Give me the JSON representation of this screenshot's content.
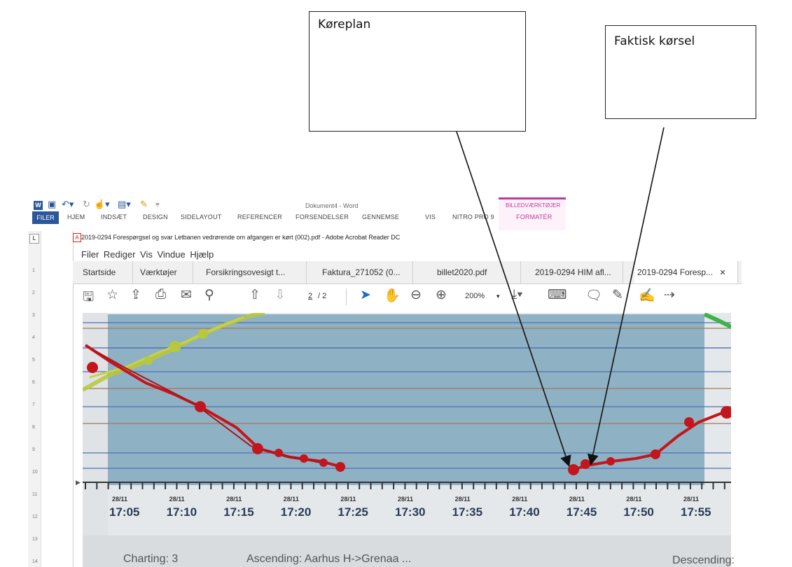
{
  "callouts": {
    "koreplan": "Køreplan",
    "faktisk": "Faktisk kørsel"
  },
  "word": {
    "title": "Dokument4 - Word",
    "tabs": [
      "FILER",
      "HJEM",
      "INDSÆT",
      "DESIGN",
      "SIDELAYOUT",
      "REFERENCER",
      "FORSENDELSER",
      "GENNEMSE",
      "VIS",
      "NITRO PRO 9"
    ],
    "context_group": "BILLEDVÆRKTØJER",
    "context_tab": "FORMATÉR",
    "ruler_numbers": [
      "1",
      "2",
      "3",
      "4",
      "5",
      "6",
      "7",
      "8",
      "9",
      "10",
      "11",
      "12",
      "13",
      "14"
    ]
  },
  "acrobat": {
    "window_title": "2019-0294 Forespørgsel og svar Letbanen vedrørende om afgangen er kørt (002).pdf - Adobe Acrobat Reader DC",
    "menu": "Filer  Rediger  Vis  Vindue  Hjælp",
    "tabs": [
      "Startside",
      "Værktøjer",
      "Forsikringsovesigt t...",
      "Faktura_271052 (0...",
      "billet2020.pdf",
      "2019-0294 HIM afl...",
      "2019-0294 Foresp..."
    ],
    "page_current": "2",
    "page_total": "/ 2",
    "zoom": "200%"
  },
  "photo": {
    "time_labels": [
      "17:05",
      "17:10",
      "17:15",
      "17:20",
      "17:25",
      "17:30",
      "17:35",
      "17:40",
      "17:45",
      "17:50",
      "17:55"
    ],
    "date_label": "28/11",
    "footer_left": "Charting: 3",
    "footer_mid": "Ascending: Aarhus H->Grenaa ...",
    "footer_right": "Descending:"
  },
  "colors": {
    "word_blue": "#2b579a",
    "context_pink": "#c0399a",
    "plot_bg": "#8fb1c4",
    "route_red": "#c2161c",
    "route_yellow": "#b9c83a",
    "route_green": "#3db34a"
  }
}
